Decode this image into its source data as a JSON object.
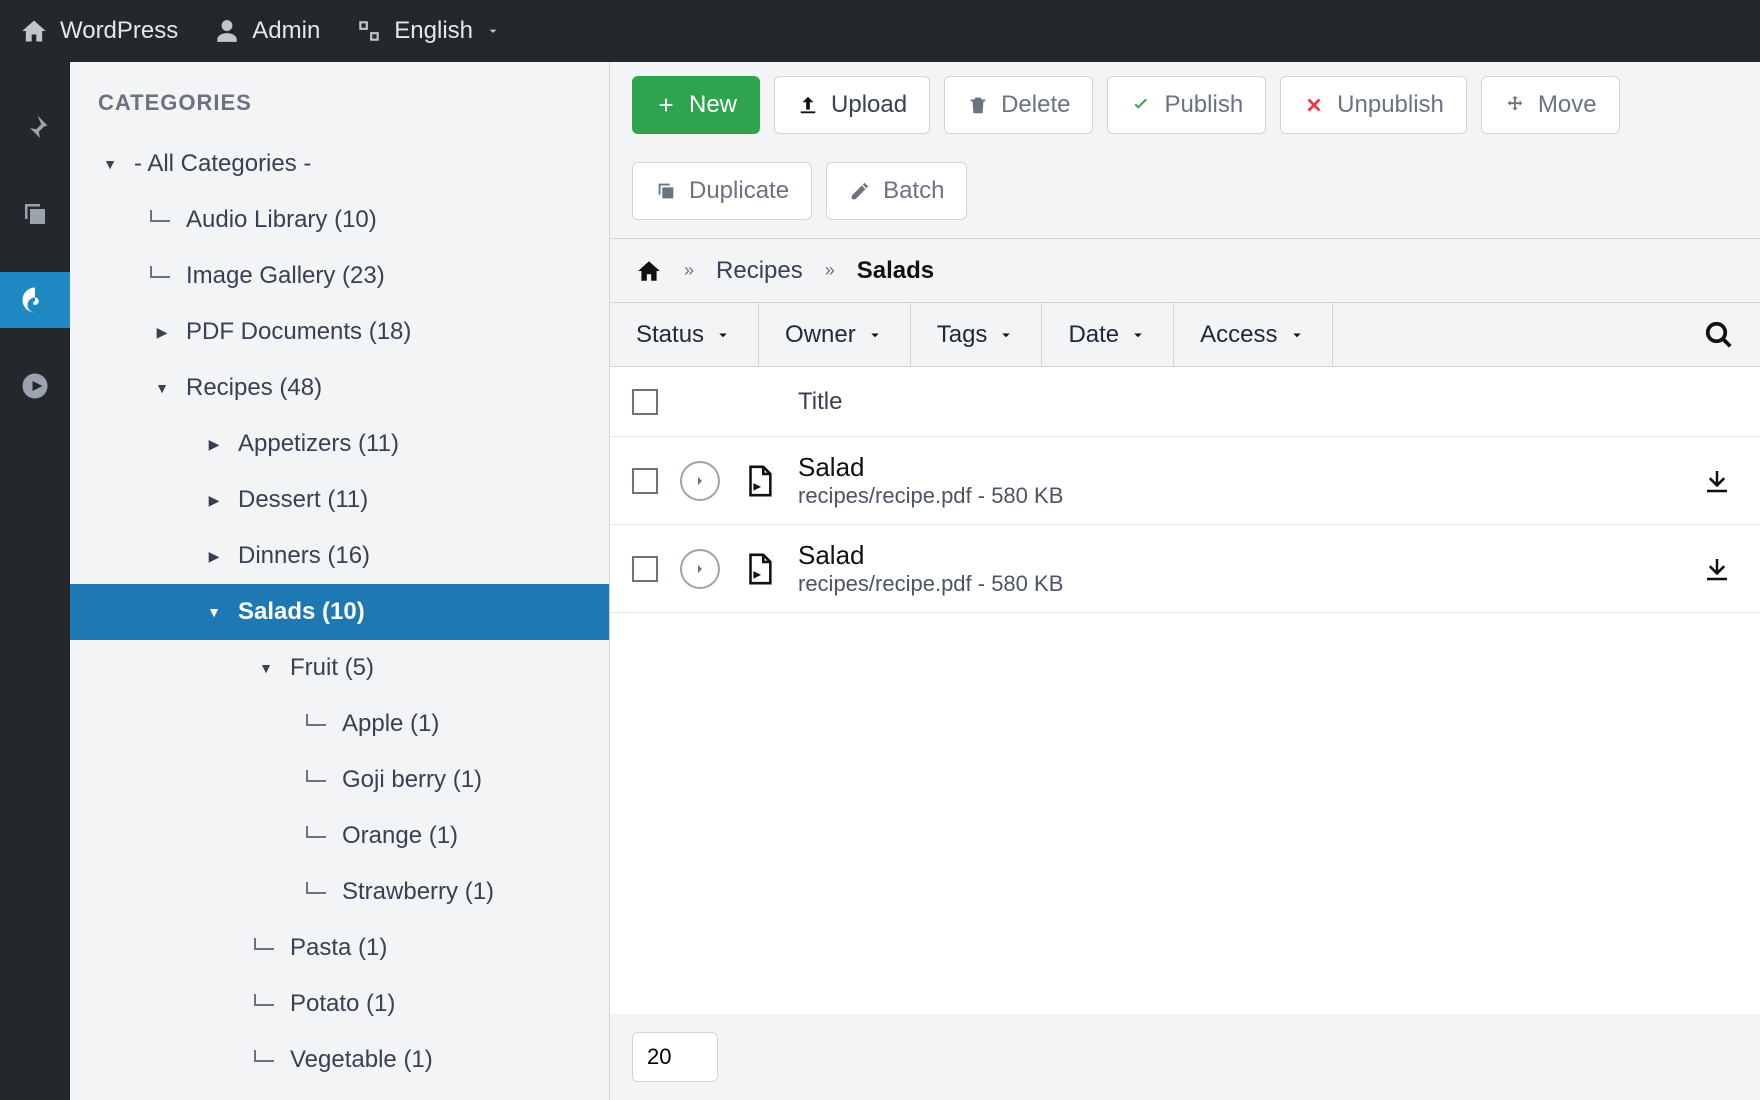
{
  "topbar": {
    "site": "WordPress",
    "user": "Admin",
    "language": "English"
  },
  "sidebar": {
    "title": "CATEGORIES",
    "tree": [
      {
        "label": "- All Categories -",
        "depth": 0,
        "expanded": true,
        "hasChildren": true
      },
      {
        "label": "Audio Library (10)",
        "depth": 1,
        "leaf": true
      },
      {
        "label": "Image Gallery (23)",
        "depth": 1,
        "leaf": true
      },
      {
        "label": "PDF Documents (18)",
        "depth": 1,
        "hasChildren": true,
        "expanded": false
      },
      {
        "label": "Recipes (48)",
        "depth": 1,
        "hasChildren": true,
        "expanded": true
      },
      {
        "label": "Appetizers (11)",
        "depth": 2,
        "hasChildren": true,
        "expanded": false
      },
      {
        "label": "Dessert (11)",
        "depth": 2,
        "hasChildren": true,
        "expanded": false
      },
      {
        "label": "Dinners (16)",
        "depth": 2,
        "hasChildren": true,
        "expanded": false
      },
      {
        "label": "Salads (10)",
        "depth": 2,
        "hasChildren": true,
        "expanded": true,
        "selected": true
      },
      {
        "label": "Fruit (5)",
        "depth": 3,
        "hasChildren": true,
        "expanded": true
      },
      {
        "label": "Apple (1)",
        "depth": 4,
        "leaf": true
      },
      {
        "label": "Goji berry (1)",
        "depth": 4,
        "leaf": true
      },
      {
        "label": "Orange (1)",
        "depth": 4,
        "leaf": true
      },
      {
        "label": "Strawberry (1)",
        "depth": 4,
        "leaf": true
      },
      {
        "label": "Pasta (1)",
        "depth": 3,
        "leaf": true
      },
      {
        "label": "Potato (1)",
        "depth": 3,
        "leaf": true
      },
      {
        "label": "Vegetable (1)",
        "depth": 3,
        "leaf": true
      }
    ]
  },
  "toolbar": {
    "new": "New",
    "upload": "Upload",
    "delete": "Delete",
    "publish": "Publish",
    "unpublish": "Unpublish",
    "move": "Move",
    "duplicate": "Duplicate",
    "batch": "Batch"
  },
  "breadcrumb": {
    "items": [
      "Recipes"
    ],
    "current": "Salads"
  },
  "filters": {
    "status": "Status",
    "owner": "Owner",
    "tags": "Tags",
    "date": "Date",
    "access": "Access"
  },
  "table": {
    "title_header": "Title",
    "rows": [
      {
        "title": "Salad",
        "path": "recipes/recipe.pdf",
        "size": "580 KB"
      },
      {
        "title": "Salad",
        "path": "recipes/recipe.pdf",
        "size": "580 KB"
      }
    ]
  },
  "pager": {
    "value": "20"
  }
}
